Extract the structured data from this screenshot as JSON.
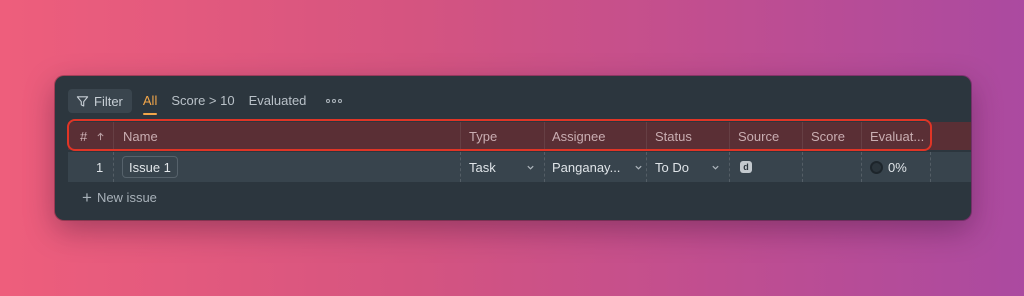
{
  "toolbar": {
    "filter_label": "Filter",
    "views": [
      {
        "label": "All",
        "active": true
      },
      {
        "label": "Score > 10",
        "active": false
      },
      {
        "label": "Evaluated",
        "active": false
      }
    ],
    "more_icon": "more-horizontal-icon"
  },
  "columns": {
    "index": "#",
    "sort_icon": "arrow-up-icon",
    "name": "Name",
    "type": "Type",
    "assignee": "Assignee",
    "status": "Status",
    "source": "Source",
    "score": "Score",
    "evaluated": "Evaluat..."
  },
  "rows": [
    {
      "index": "1",
      "name": "Issue 1",
      "type": "Task",
      "assignee": "Panganay...",
      "status": "To Do",
      "source_badge": "d",
      "score": "",
      "evaluated": "0%"
    }
  ],
  "new_issue_label": "New issue",
  "colors": {
    "accent": "#f2a64a",
    "highlight": "#e03526",
    "panel": "#2c363e"
  }
}
